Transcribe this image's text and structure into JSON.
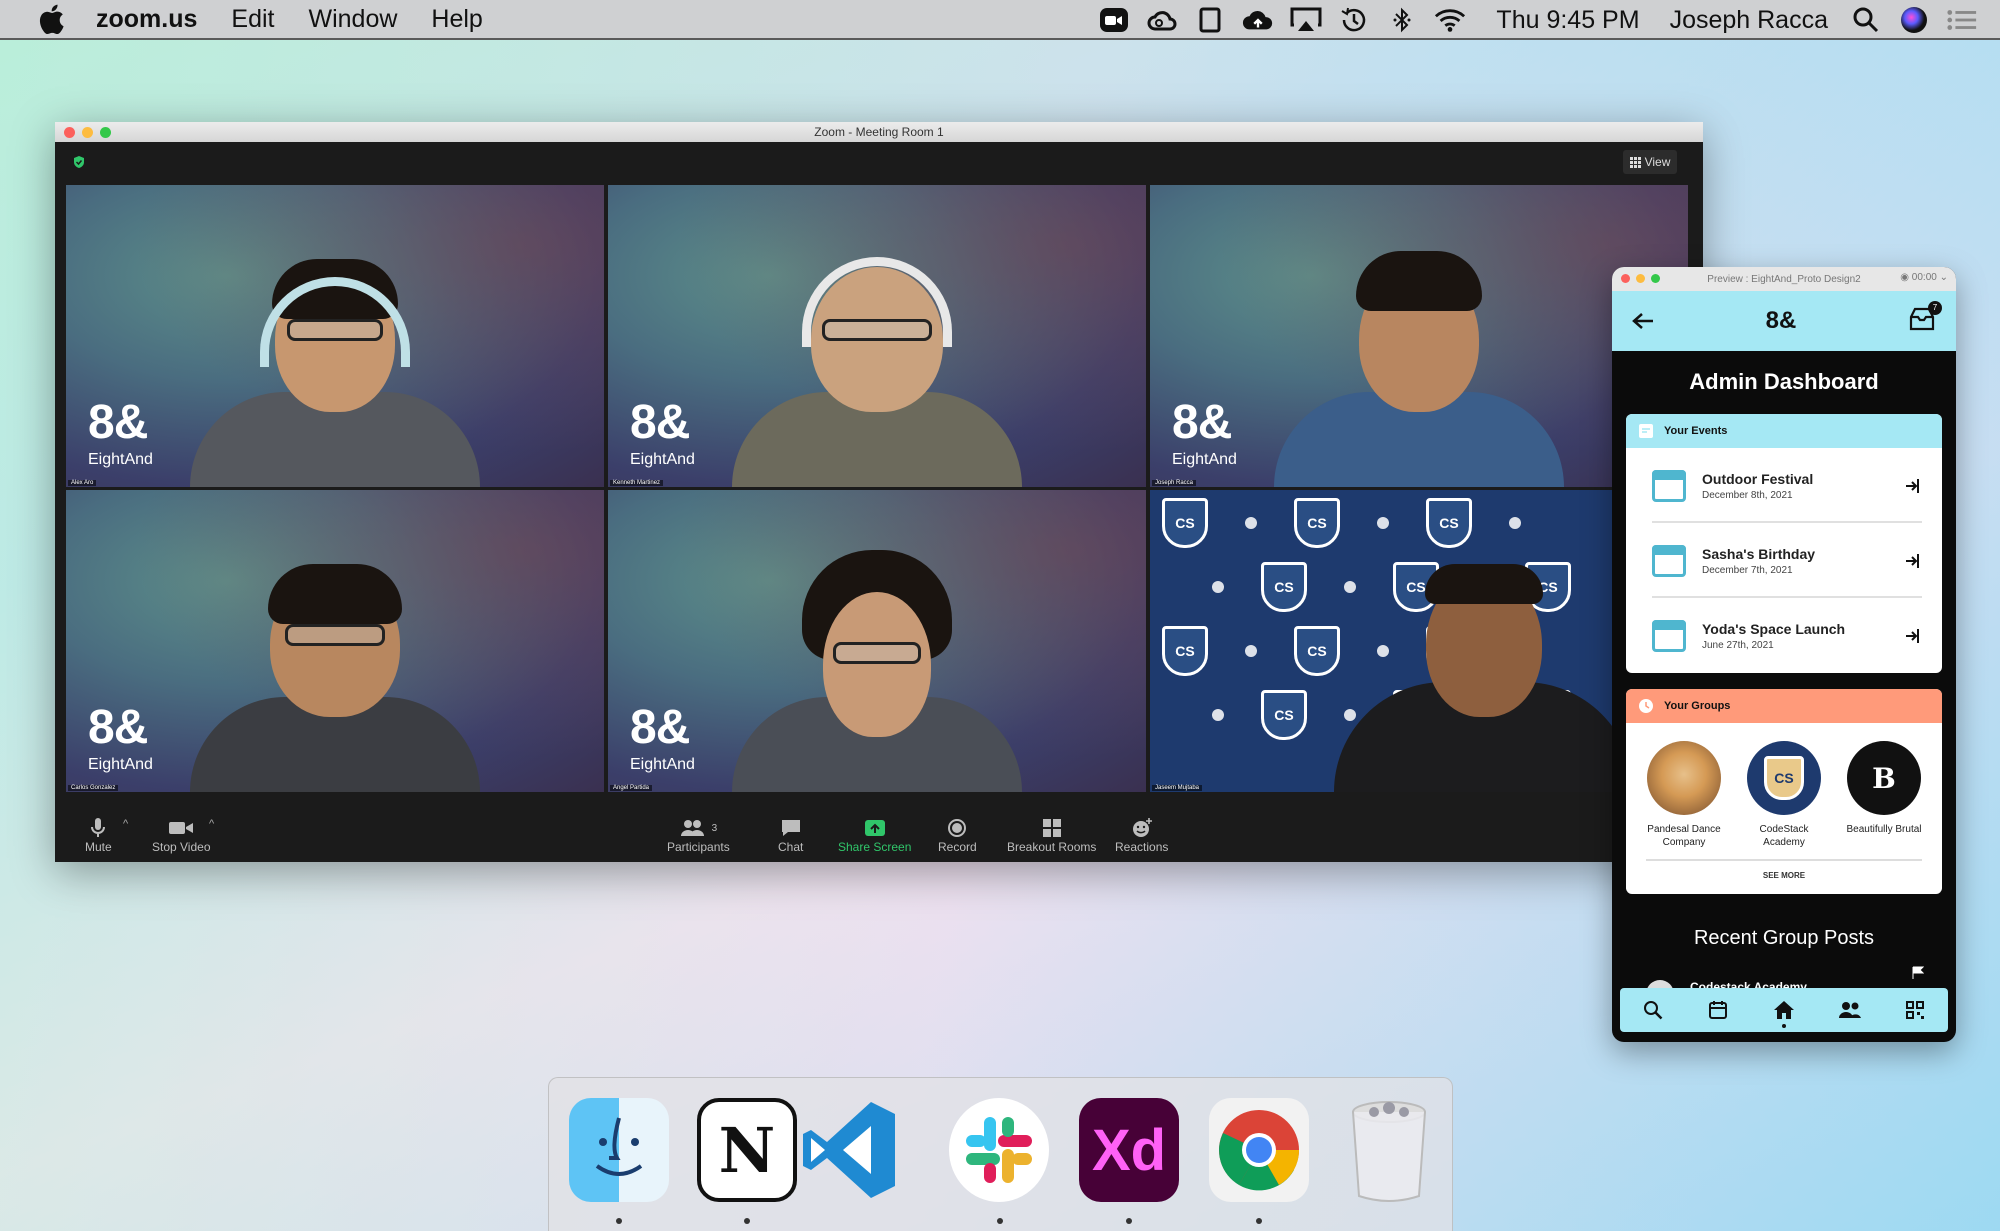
{
  "menubar": {
    "app_name": "zoom.us",
    "menus": [
      "Edit",
      "Window",
      "Help"
    ],
    "clock": "Thu 9:45 PM",
    "user": "Joseph Racca",
    "icons": [
      "zoom-camera-icon",
      "creative-cloud-icon",
      "screen-icon",
      "cloud-upload-icon",
      "airplay-icon",
      "time-machine-icon",
      "bluetooth-icon",
      "wifi-icon",
      "search-icon",
      "siri-icon",
      "control-center-icon"
    ]
  },
  "zoom": {
    "window_title": "Zoom - Meeting Room 1",
    "view_label": "View",
    "participants": [
      {
        "name": "Alex Aro",
        "brand_big": "8&",
        "brand_small": "EightAnd"
      },
      {
        "name": "Kenneth Martinez",
        "brand_big": "8&",
        "brand_small": "EightAnd"
      },
      {
        "name": "Joseph Racca",
        "brand_big": "8&",
        "brand_small": "EightAnd"
      },
      {
        "name": "Carlos Gonzalez",
        "brand_big": "8&",
        "brand_small": "EightAnd"
      },
      {
        "name": "Angel Partida",
        "brand_big": "8&",
        "brand_small": "EightAnd"
      },
      {
        "name": "Jaseem Mujtaba",
        "logo_letters": "CS"
      }
    ],
    "toolbar": {
      "mute": "Mute",
      "stop_video": "Stop Video",
      "participants": "Participants",
      "participants_count": "3",
      "chat": "Chat",
      "share_screen": "Share Screen",
      "record": "Record",
      "breakout_rooms": "Breakout Rooms",
      "reactions": "Reactions"
    },
    "accent_color": "#30c66a"
  },
  "preview": {
    "window_title": "Preview : EightAnd_Proto Design2",
    "timer": "00:00",
    "logo": "8&",
    "inbox_badge": "7",
    "page_title": "Admin Dashboard",
    "events_header": "Your Events",
    "events": [
      {
        "title": "Outdoor Festival",
        "date": "December 8th, 2021"
      },
      {
        "title": "Sasha's Birthday",
        "date": "December 7th, 2021"
      },
      {
        "title": "Yoda's Space Launch",
        "date": "June 27th, 2021"
      }
    ],
    "groups_header": "Your Groups",
    "groups": [
      {
        "name": "Pandesal Dance Company"
      },
      {
        "name": "CodeStack Academy",
        "logo": "CS"
      },
      {
        "name": "Beautifully Brutal",
        "logo": "B"
      }
    ],
    "see_more": "SEE MORE",
    "recent_posts_title": "Recent Group Posts",
    "recent_post_group": "Codestack Academy",
    "accent_blue": "#a5e8f4",
    "accent_orange": "#ff9a7a"
  },
  "dock": {
    "apps": [
      "Finder",
      "Notion",
      "Visual Studio Code",
      "Slack",
      "Adobe XD",
      "Google Chrome",
      "Trash"
    ],
    "xd_label": "Xd",
    "notion_label": "N"
  }
}
